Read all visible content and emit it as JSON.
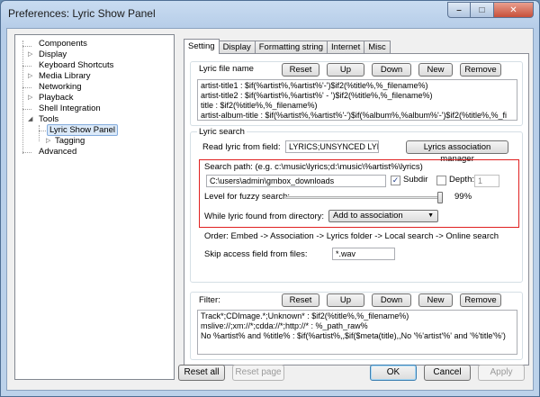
{
  "window": {
    "title": "Preferences: Lyric Show Panel"
  },
  "caption": {
    "min": "–",
    "max": "□",
    "close": "✕"
  },
  "tree": {
    "items": [
      {
        "label": "Components"
      },
      {
        "label": "Display"
      },
      {
        "label": "Keyboard Shortcuts"
      },
      {
        "label": "Media Library"
      },
      {
        "label": "Networking"
      },
      {
        "label": "Playback"
      },
      {
        "label": "Shell Integration"
      },
      {
        "label": "Tools"
      },
      {
        "label": "Lyric Show Panel"
      },
      {
        "label": "Tagging"
      },
      {
        "label": "Advanced"
      }
    ]
  },
  "tabs": [
    "Setting",
    "Display",
    "Formatting string",
    "Internet",
    "Misc"
  ],
  "lyric_file_name": {
    "label": "Lyric file name",
    "buttons": {
      "reset": "Reset",
      "up": "Up",
      "down": "Down",
      "new": "New",
      "remove": "Remove"
    },
    "lines": [
      "artist-title1 : $if(%artist%,%artist%'-')$if2(%title%,%_filename%)",
      "artist-title2 : $if(%artist%,%artist%' - ')$if2(%title%,%_filename%)",
      "title : $if2(%title%,%_filename%)",
      "artist-album-title : $if(%artist%,%artist%'-')$if(%album%,%album%'-')$if2(%title%,%_fi"
    ]
  },
  "lyric_search": {
    "label": "Lyric search",
    "read_label": "Read lyric from field:",
    "read_value": "LYRICS;UNSYNCED LYRICS",
    "assoc_button": "Lyrics association manager",
    "search_path_label": "Search path: (e.g. c:\\music\\lyrics;d:\\music\\%artist%\\lyrics)",
    "search_path_value": "C:\\users\\admin\\gmbox_downloads",
    "subdir_label": "Subdir",
    "subdir_checked": true,
    "depth_label": "Depth:",
    "depth_checked": false,
    "depth_value": "1",
    "fuzzy_label": "Level for fuzzy search:",
    "fuzzy_value": "99%",
    "fuzzy_level": 0.99,
    "while_label": "While lyric found from directory:",
    "while_value": "Add to association",
    "order_text": "Order: Embed -> Association -> Lyrics folder -> Local search -> Online search",
    "skip_label": "Skip access field from files:",
    "skip_value": "*.wav"
  },
  "filter": {
    "label": "Filter:",
    "buttons": {
      "reset": "Reset",
      "up": "Up",
      "down": "Down",
      "new": "New",
      "remove": "Remove"
    },
    "lines": [
      "Track*;CDImage.*;Unknown* : $if2(%title%,%_filename%)",
      "mslive://;xm://*;cdda://*;http://* : %_path_raw%",
      "No %artist% and %title% : $if(%artist%,,$if($meta(title),,No '%'artist'%' and '%'title'%')"
    ]
  },
  "footer": {
    "reset_all": "Reset all",
    "reset_page": "Reset page",
    "ok": "OK",
    "cancel": "Cancel",
    "apply": "Apply"
  },
  "colors": {
    "highlight_box": "#e02020",
    "selection": "#dbe9f8"
  }
}
